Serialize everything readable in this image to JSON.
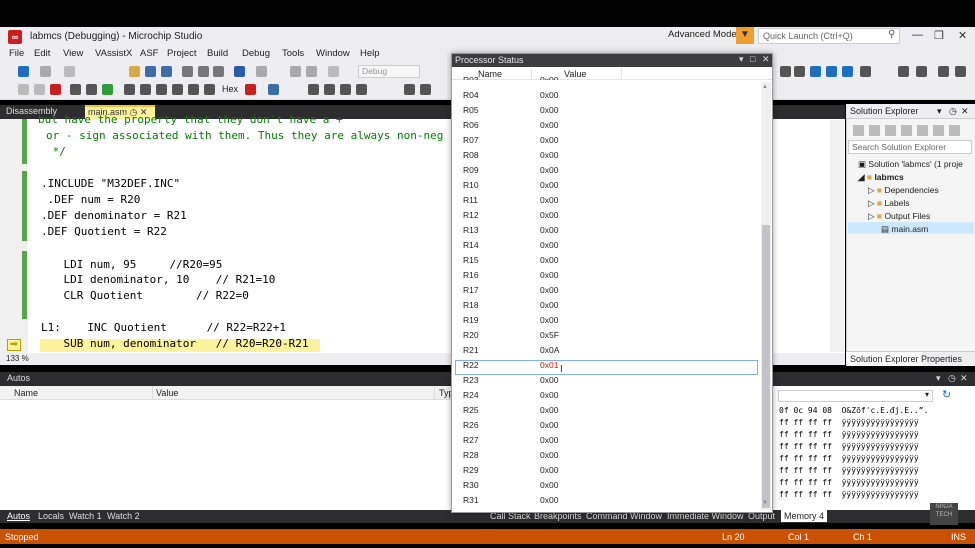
{
  "window": {
    "title": "labmcs (Debugging) - Microchip Studio",
    "advanced_mode": "Advanced Mode",
    "quick_launch": "Quick Launch (Ctrl+Q)"
  },
  "menu": [
    "File",
    "Edit",
    "View",
    "VAssistX",
    "ASF",
    "Project",
    "Build",
    "Debug",
    "Tools",
    "Window",
    "Help"
  ],
  "toolbar": {
    "config": "Debug",
    "zoom": "133 %",
    "hex_label": "Hex"
  },
  "tabs": {
    "disassembly": "Disassembly",
    "main": "main.asm"
  },
  "code": {
    "lines": [
      "but have the property that they don't have a +",
      "or - sign associated with them. Thus they are always non-neg",
      " */",
      "",
      ".INCLUDE \"M32DEF.INC\"",
      " .DEF num = R20",
      ".DEF denominator = R21",
      ".DEF Quotient = R22",
      "",
      "    LDI num, 95     //R20=95",
      "    LDI denominator, 10    // R21=10",
      "    CLR Quotient        // R22=0",
      "",
      "L1:    INC Quotient      // R22=R22+1",
      "    SUB num, denominator   // R20=R20-R21"
    ]
  },
  "solution_explorer": {
    "title": "Solution Explorer",
    "search": "Search Solution Explorer",
    "solution": "Solution 'labmcs' (1 proje",
    "project": "labmcs",
    "items": [
      "Dependencies",
      "Labels",
      "Output Files",
      "main.asm"
    ],
    "tabs": [
      "Solution Explorer",
      "Properties"
    ]
  },
  "autos": {
    "title": "Autos",
    "col_name": "Name",
    "col_value": "Value",
    "col_type": "Typ"
  },
  "bottom_tabs_left": [
    "Autos",
    "Locals",
    "Watch 1",
    "Watch 2"
  ],
  "bottom_tabs_right": [
    "Call Stack",
    "Breakpoints",
    "Command Window",
    "Immediate Window",
    "Output",
    "Memory 4"
  ],
  "processor_status": {
    "title": "Processor Status",
    "col_name": "Name",
    "col_value": "Value",
    "rows": [
      {
        "name": "R03",
        "value": "0x00"
      },
      {
        "name": "R04",
        "value": "0x00"
      },
      {
        "name": "R05",
        "value": "0x00"
      },
      {
        "name": "R06",
        "value": "0x00"
      },
      {
        "name": "R07",
        "value": "0x00"
      },
      {
        "name": "R08",
        "value": "0x00"
      },
      {
        "name": "R09",
        "value": "0x00"
      },
      {
        "name": "R10",
        "value": "0x00"
      },
      {
        "name": "R11",
        "value": "0x00"
      },
      {
        "name": "R12",
        "value": "0x00"
      },
      {
        "name": "R13",
        "value": "0x00"
      },
      {
        "name": "R14",
        "value": "0x00"
      },
      {
        "name": "R15",
        "value": "0x00"
      },
      {
        "name": "R16",
        "value": "0x00"
      },
      {
        "name": "R17",
        "value": "0x00"
      },
      {
        "name": "R18",
        "value": "0x00"
      },
      {
        "name": "R19",
        "value": "0x00"
      },
      {
        "name": "R20",
        "value": "0x5F"
      },
      {
        "name": "R21",
        "value": "0x0A"
      },
      {
        "name": "R22",
        "value": "0x01"
      },
      {
        "name": "R23",
        "value": "0x00"
      },
      {
        "name": "R24",
        "value": "0x00"
      },
      {
        "name": "R25",
        "value": "0x00"
      },
      {
        "name": "R26",
        "value": "0x00"
      },
      {
        "name": "R27",
        "value": "0x00"
      },
      {
        "name": "R28",
        "value": "0x00"
      },
      {
        "name": "R29",
        "value": "0x00"
      },
      {
        "name": "R30",
        "value": "0x00"
      },
      {
        "name": "R31",
        "value": "0x00"
      }
    ],
    "changed_color": "#e51400"
  },
  "memory": {
    "lines": [
      "0f 0c 94 08  O&Zõf'c.E.đj.E..”.",
      "ff ff ff ff  ÿÿÿÿÿÿÿÿÿÿÿÿÿÿÿÿ",
      "ff ff ff ff  ÿÿÿÿÿÿÿÿÿÿÿÿÿÿÿÿ",
      "ff ff ff ff  ÿÿÿÿÿÿÿÿÿÿÿÿÿÿÿÿ",
      "ff ff ff ff  ÿÿÿÿÿÿÿÿÿÿÿÿÿÿÿÿ",
      "ff ff ff ff  ÿÿÿÿÿÿÿÿÿÿÿÿÿÿÿÿ",
      "ff ff ff ff  ÿÿÿÿÿÿÿÿÿÿÿÿÿÿÿÿ",
      "ff ff ff ff  ÿÿÿÿÿÿÿÿÿÿÿÿÿÿÿÿ",
      "ff ff ff ff  ÿÿÿÿÿÿÿÿÿÿÿÿÿÿÿÿ"
    ]
  },
  "status": {
    "state": "Stopped",
    "line": "Ln 20",
    "col": "Col 1",
    "ch": "Ch 1",
    "mode": "INS"
  }
}
